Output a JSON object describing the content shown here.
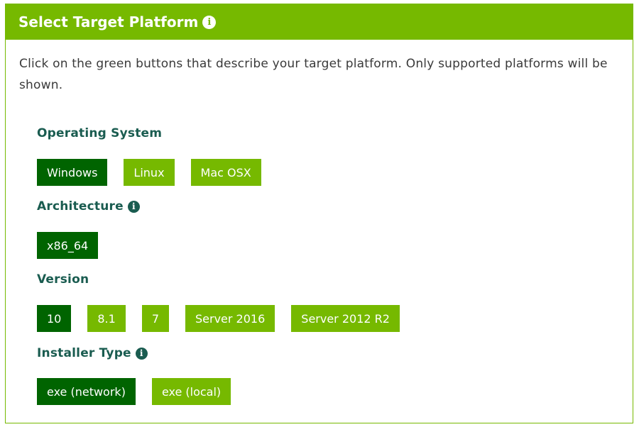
{
  "header": {
    "title": "Select Target Platform",
    "info_icon": "i"
  },
  "intro_text": "Click on the green buttons that describe your target platform. Only supported platforms will be shown.",
  "colors": {
    "accent": "#76b900",
    "selected": "#006400",
    "section_title": "#1a5c50"
  },
  "sections": [
    {
      "title": "Operating System",
      "has_info": false,
      "options": [
        {
          "label": "Windows",
          "selected": true
        },
        {
          "label": "Linux",
          "selected": false
        },
        {
          "label": "Mac OSX",
          "selected": false
        }
      ]
    },
    {
      "title": "Architecture",
      "has_info": true,
      "options": [
        {
          "label": "x86_64",
          "selected": true
        }
      ]
    },
    {
      "title": "Version",
      "has_info": false,
      "options": [
        {
          "label": "10",
          "selected": true
        },
        {
          "label": "8.1",
          "selected": false
        },
        {
          "label": "7",
          "selected": false
        },
        {
          "label": "Server 2016",
          "selected": false
        },
        {
          "label": "Server 2012 R2",
          "selected": false
        }
      ]
    },
    {
      "title": "Installer Type",
      "has_info": true,
      "options": [
        {
          "label": "exe (network)",
          "selected": true
        },
        {
          "label": "exe (local)",
          "selected": false
        }
      ]
    }
  ]
}
